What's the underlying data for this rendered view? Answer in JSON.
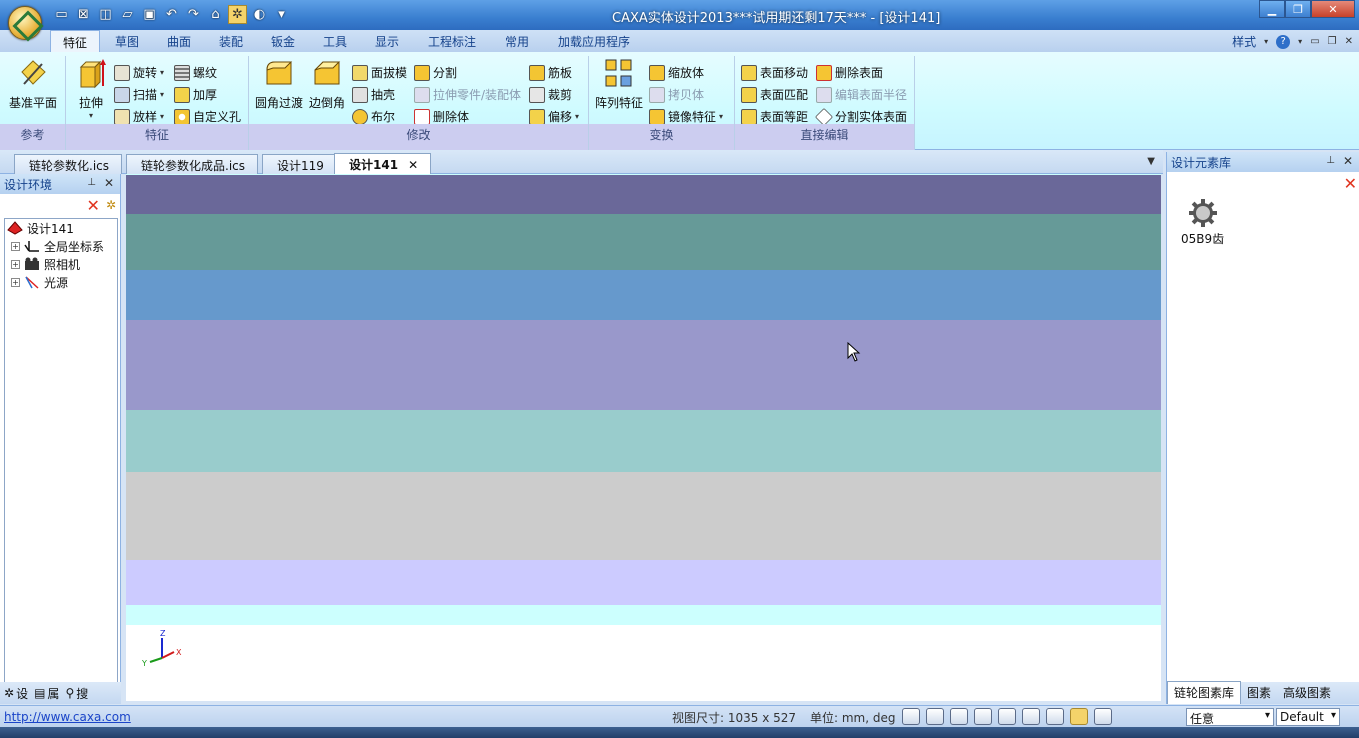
{
  "window": {
    "title": "CAXA实体设计2013***试用期还剩17天*** - [设计141]"
  },
  "ribbon": {
    "tabs": [
      "特征",
      "草图",
      "曲面",
      "装配",
      "钣金",
      "工具",
      "显示",
      "工程标注",
      "常用",
      "加载应用程序"
    ],
    "active_tab": "特征",
    "style_label": "样式",
    "groups": {
      "reference": {
        "label": "参考",
        "plane": "基准平面"
      },
      "feature": {
        "label": "特征",
        "extrude": "拉伸",
        "revolve": "旋转",
        "sweep": "扫描",
        "loft": "放样",
        "thread": "螺纹",
        "thicken": "加厚",
        "custom_hole": "自定义孔"
      },
      "modify": {
        "label": "修改",
        "fillet": "圆角过渡",
        "chamfer": "边倒角",
        "draft": "面拔模",
        "shell": "抽壳",
        "boolean": "布尔",
        "split": "分割",
        "extrude_part": "拉伸零件/装配体",
        "delete_body": "删除体",
        "rib": "筋板",
        "trim": "裁剪",
        "offset": "偏移"
      },
      "transform": {
        "label": "变换",
        "pattern": "阵列特征",
        "scale": "缩放体",
        "copy": "拷贝体",
        "mirror": "镜像特征"
      },
      "direct_edit": {
        "label": "直接编辑",
        "move_face": "表面移动",
        "match_face": "表面匹配",
        "offset_face": "表面等距",
        "delete_face": "删除表面",
        "edit_radius": "编辑表面半径",
        "split_body_face": "分割实体表面"
      }
    }
  },
  "doc_tabs": [
    "链轮参数化.ics",
    "链轮参数化成品.ics",
    "设计119",
    "设计141"
  ],
  "left_panel": {
    "title": "设计环境",
    "tree": [
      "设计141",
      "全局坐标系",
      "照相机",
      "光源"
    ],
    "bottom_tabs": [
      "设",
      "属",
      "搜"
    ]
  },
  "viewport": {
    "bands": [
      {
        "color": "#ccfffe",
        "from": 0,
        "to": 1
      },
      {
        "color": "#6a6899",
        "from": 1,
        "to": 40
      },
      {
        "color": "#669a98",
        "from": 40,
        "to": 96
      },
      {
        "color": "#6699cc",
        "from": 96,
        "to": 146
      },
      {
        "color": "#9998cb",
        "from": 146,
        "to": 236
      },
      {
        "color": "#99cccc",
        "from": 236,
        "to": 298
      },
      {
        "color": "#cccccc",
        "from": 298,
        "to": 386
      },
      {
        "color": "#cccbff",
        "from": 386,
        "to": 431
      },
      {
        "color": "#ccfffe",
        "from": 431,
        "to": 451
      }
    ],
    "axes": {
      "z": "Z",
      "y": "Y",
      "x": "X"
    }
  },
  "right_panel": {
    "title": "设计元素库",
    "item_label": "05B9齿",
    "tabs": [
      "链轮图素库",
      "图素",
      "高级图素"
    ]
  },
  "status": {
    "link": "http://www.caxa.com",
    "view_size": "视图尺寸: 1035 x  527",
    "units": "单位: mm, deg",
    "filter": "任意",
    "style": "Default"
  }
}
